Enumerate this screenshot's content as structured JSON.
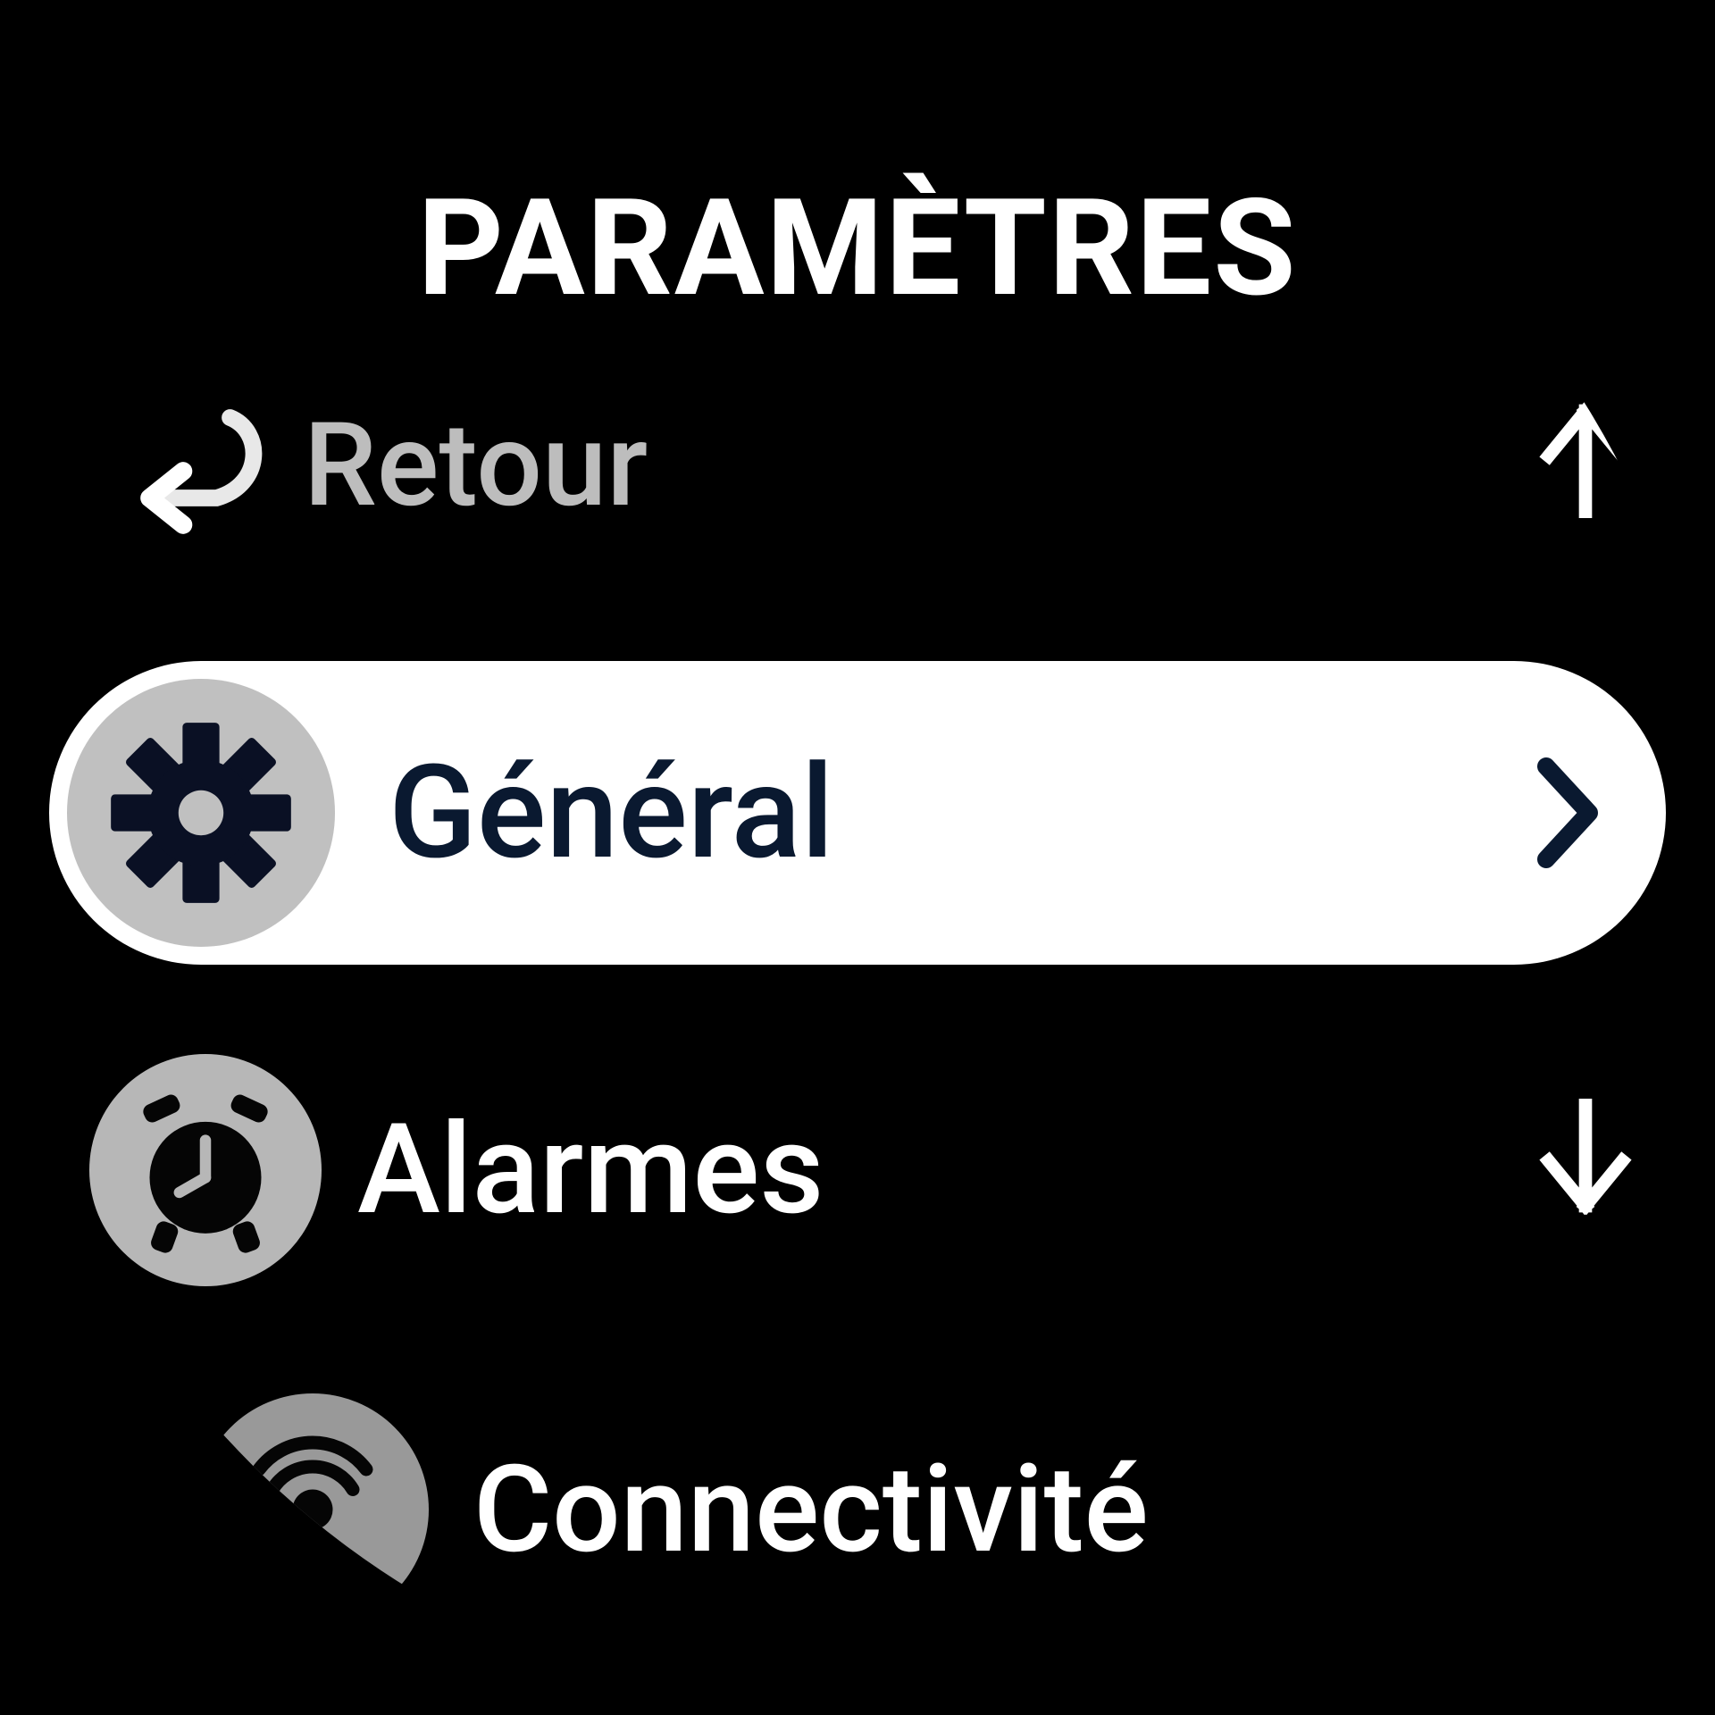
{
  "header": {
    "title": "PARAMÈTRES"
  },
  "rows": {
    "back": {
      "label": "Retour",
      "icon": "return-icon"
    },
    "general": {
      "label": "Général",
      "icon": "gear-icon",
      "selected": true
    },
    "alarms": {
      "label": "Alarmes",
      "icon": "alarm-clock-icon"
    },
    "connectivity": {
      "label": "Connectivité",
      "icon": "connectivity-icon"
    }
  },
  "scroll": {
    "up": "↑",
    "down": "↓"
  },
  "chevron_right": ">",
  "colors": {
    "bg": "#000000",
    "text_primary": "#ffffff",
    "text_dim": "#bdbdbd",
    "pill_bg": "#ffffff",
    "pill_text": "#0a1930",
    "icon_bg": "#b7b7b7"
  }
}
